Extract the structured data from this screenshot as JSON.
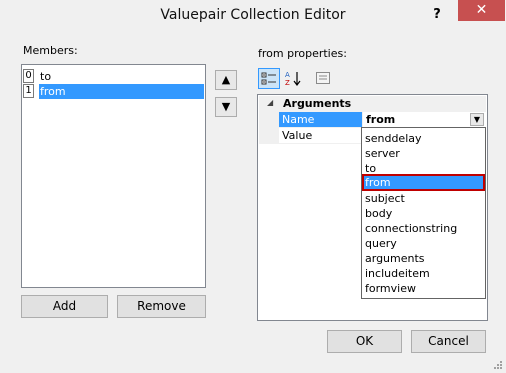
{
  "window": {
    "title": "Valuepair Collection Editor",
    "help_glyph": "?",
    "close_glyph": "✕"
  },
  "members": {
    "label": "Members:",
    "items": [
      {
        "index": "0",
        "name": "to"
      },
      {
        "index": "1",
        "name": "from"
      }
    ],
    "move_up_glyph": "▲",
    "move_down_glyph": "▼",
    "add_label": "Add",
    "remove_label": "Remove"
  },
  "properties": {
    "label": "from properties:",
    "category": "Arguments",
    "rows": [
      {
        "name": "Name",
        "value": "from"
      },
      {
        "name": "Value",
        "value": ""
      }
    ],
    "dropdown_options": [
      "senddelay",
      "server",
      "to",
      "from",
      "subject",
      "body",
      "connectionstring",
      "query",
      "arguments",
      "includeitem",
      "formview"
    ],
    "selected_option": "from"
  },
  "footer": {
    "ok_label": "OK",
    "cancel_label": "Cancel"
  },
  "colors": {
    "selection": "#3399ff",
    "highlight_border": "#c00000",
    "close_button": "#c75050"
  }
}
